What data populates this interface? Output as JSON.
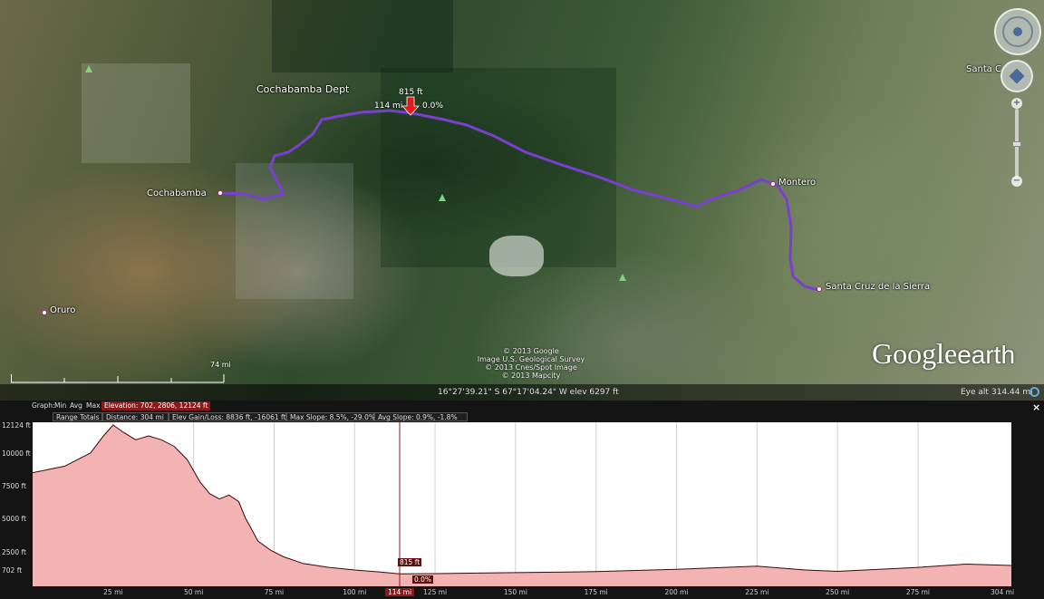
{
  "map": {
    "places": {
      "cochabamba_dept": "Cochabamba Dept",
      "cochabamba": "Cochabamba",
      "oruro": "Oruro",
      "montero": "Montero",
      "santa_cruz": "Santa Cruz de la Sierra",
      "santa_c_partial": "Santa C"
    },
    "cursor_marker": {
      "elevation": "815 ft",
      "distance": "114 mi",
      "slope": "0.0%"
    },
    "scale_label": "74 mi",
    "copyright": [
      "© 2013 Google",
      "Image U.S. Geological Survey",
      "© 2013 Cnes/Spot Image",
      "© 2013 Mapcity"
    ],
    "logo": {
      "google": "Google",
      "earth": "earth"
    },
    "route_color": "#7b3fd0"
  },
  "status": {
    "coords": "16°27'39.21\" S  67°17'04.24\" W  elev  6297 ft",
    "eye_alt_label": "Eye alt",
    "eye_alt_value": "314.44 mi"
  },
  "profile": {
    "header": {
      "graph_label": "Graph:",
      "min_label": "Min",
      "avg_label": "Avg",
      "max_label": "Max",
      "elevation": "Elevation: 702, 2806, 12124 ft"
    },
    "totals": {
      "range_totals": "Range Totals",
      "distance": "Distance: 304 mi",
      "elev_gain_loss": "Elev Gain/Loss: 8836 ft, -16061 ft",
      "max_slope": "Max Slope: 8.5%, -29.0%",
      "avg_slope": "Avg Slope: 0.9%, -1.8%"
    },
    "y_ticks": [
      "12124 ft",
      "10000 ft",
      "7500 ft",
      "5000 ft",
      "2500 ft",
      "702 ft"
    ],
    "x_ticks": [
      "25 mi",
      "50 mi",
      "75 mi",
      "100 mi",
      "114 mi",
      "125 mi",
      "150 mi",
      "175 mi",
      "200 mi",
      "225 mi",
      "250 mi",
      "275 mi",
      "304 mi"
    ],
    "cursor": {
      "elevation": "815 ft",
      "slope": "0.0%",
      "distance": "114 mi"
    },
    "fill_color": "#f3b3b3",
    "line_color": "#3a0a0a"
  },
  "chart_data": {
    "type": "area",
    "title": "",
    "xlabel": "",
    "ylabel": "",
    "x_unit": "mi",
    "y_unit": "ft",
    "xlim": [
      0,
      304
    ],
    "ylim": [
      702,
      12124
    ],
    "x": [
      0,
      10,
      18,
      22,
      25,
      28,
      32,
      36,
      40,
      44,
      48,
      52,
      55,
      58,
      61,
      64,
      66,
      68,
      70,
      74,
      78,
      84,
      92,
      100,
      108,
      114,
      125,
      150,
      175,
      200,
      225,
      240,
      250,
      275,
      290,
      304
    ],
    "series": [
      {
        "values": [
          8500,
          9000,
          10000,
          11300,
          12124,
          11600,
          11000,
          11300,
          11000,
          10500,
          9500,
          7800,
          6900,
          6500,
          6800,
          6300,
          5100,
          4200,
          3300,
          2600,
          2100,
          1600,
          1300,
          1100,
          950,
          815,
          830,
          900,
          980,
          1150,
          1400,
          1100,
          1000,
          1300,
          1550,
          1450
        ]
      }
    ],
    "grid": true
  }
}
